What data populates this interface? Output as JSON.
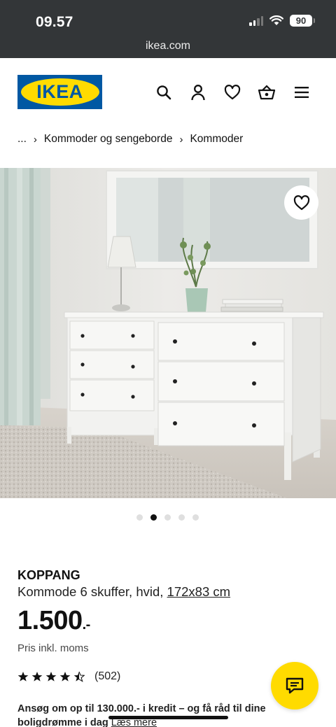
{
  "status_bar": {
    "time": "09.57",
    "battery": "90",
    "url": "ikea.com"
  },
  "header": {
    "logo_text": "IKEA",
    "icons": [
      "search-icon",
      "account-icon",
      "heart-icon",
      "basket-icon",
      "menu-icon"
    ]
  },
  "breadcrumb": {
    "ellipsis": "...",
    "items": [
      "Kommoder og sengeborde",
      "Kommoder"
    ]
  },
  "gallery": {
    "image_count": 5,
    "active_index": 1
  },
  "product": {
    "name": "KOPPANG",
    "description": "Kommode 6 skuffer, hvid, ",
    "dimensions": "172x83 cm",
    "price": "1.500",
    "price_suffix": ".-",
    "vat_note": "Pris inkl. moms",
    "rating": 4.5,
    "review_count": "(502)"
  },
  "promo": {
    "text": "Ansøg om op til 130.000.- i kredit – og få råd til dine boligdrømme i dag ",
    "link": "Læs mere"
  },
  "colors": {
    "ikea_blue": "#0058a3",
    "ikea_yellow": "#ffdb00",
    "chrome_bg": "#333638"
  }
}
